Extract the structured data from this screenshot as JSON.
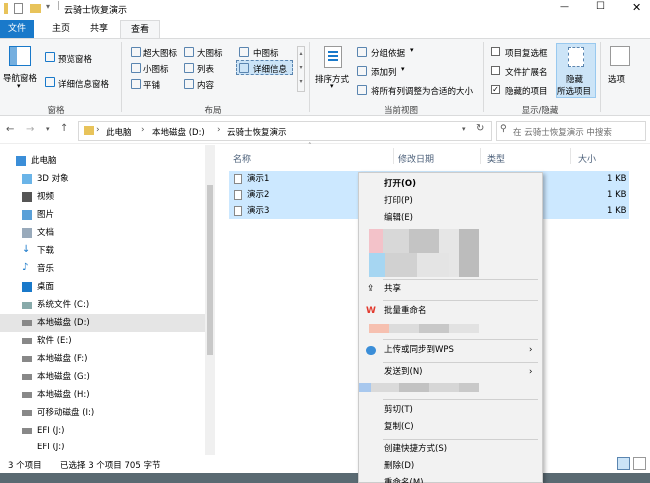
{
  "title": {
    "path_segment": "云骑士恢复演示",
    "minimize": "—",
    "maximize": "☐",
    "close": "✕"
  },
  "tabs": [
    "文件",
    "主页",
    "共享",
    "查看"
  ],
  "ribbon": {
    "pane": {
      "nav": "导航窗格",
      "preview": "预览窗格",
      "details": "详细信息窗格",
      "label": "窗格"
    },
    "layout": {
      "xlarge": "超大图标",
      "large": "大图标",
      "medium": "中图标",
      "small": "小图标",
      "list": "列表",
      "details": "详细信息",
      "tiles": "平铺",
      "content": "内容",
      "label": "布局"
    },
    "view": {
      "sort": "排序方式",
      "group": "分组依据",
      "add_col": "添加列",
      "fit": "将所有列调整为合适的大小",
      "label": "当前视图"
    },
    "showhide": {
      "checkboxes": "项目复选框",
      "ext": "文件扩展名",
      "hidden": "隐藏的项目",
      "hide_sel_1": "隐藏",
      "hide_sel_2": "所选项目",
      "options": "选项",
      "label": "显示/隐藏"
    }
  },
  "address": {
    "crumbs": [
      "此电脑",
      "本地磁盘 (D:)",
      "云骑士恢复演示"
    ],
    "search_placeholder": "在 云骑士恢复演示 中搜索"
  },
  "nav": [
    "此电脑",
    "3D 对象",
    "视频",
    "图片",
    "文档",
    "下载",
    "音乐",
    "桌面",
    "系统文件 (C:)",
    "本地磁盘 (D:)",
    "软件 (E:)",
    "本地磁盘 (F:)",
    "本地磁盘 (G:)",
    "本地磁盘 (H:)",
    "可移动磁盘 (I:)",
    "EFI (J:)",
    "EFI (J:)"
  ],
  "columns": [
    "名称",
    "修改日期",
    "类型",
    "大小"
  ],
  "files": [
    {
      "name": "演示1",
      "size": "1 KB"
    },
    {
      "name": "演示2",
      "size": "1 KB"
    },
    {
      "name": "演示3",
      "size": "1 KB"
    }
  ],
  "status": {
    "count": "3 个项目",
    "selected": "已选择 3 个项目  705 字节"
  },
  "context_menu": {
    "open": "打开(O)",
    "print": "打印(P)",
    "edit": "编辑(E)",
    "share": "共享",
    "rename": "批量重命名",
    "upload": "上传或同步到WPS",
    "sendto": "发送到(N)",
    "cut": "剪切(T)",
    "copy": "复制(C)",
    "shortcut": "创建快捷方式(S)",
    "delete": "删除(D)",
    "rename_m": "重命名(M)"
  },
  "colors": {
    "accent": "#1979ca",
    "selection": "#cce8ff"
  }
}
